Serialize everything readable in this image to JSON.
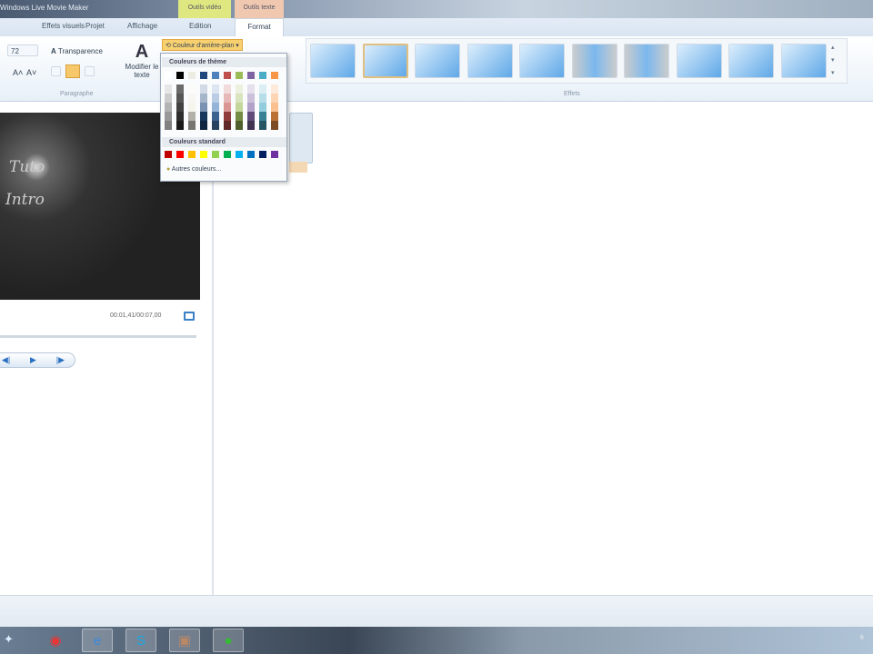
{
  "window": {
    "title": "Windows Live Movie Maker",
    "ctx_video": "Outils vidéo",
    "ctx_text": "Outils texte"
  },
  "tabs": [
    "Effets visuels",
    "Projet",
    "Affichage",
    "Edition",
    "Format"
  ],
  "ribbon": {
    "font_size": "72",
    "transparency": "Transparence",
    "modify_text": "Modifier le texte",
    "bg_color": "Couleur d'arrière-plan",
    "group_paragraph": "Paragraphe",
    "group_effects": "Effets"
  },
  "dropdown": {
    "theme_label": "Couleurs de thème",
    "standard_label": "Couleurs standard",
    "more_colors": "Autres couleurs...",
    "theme_top": [
      "#ffffff",
      "#000000",
      "#eeece1",
      "#1f497d",
      "#4f81bd",
      "#c0504d",
      "#9bbb59",
      "#8064a2",
      "#4bacc6",
      "#f79646"
    ],
    "standard": [
      "#c00000",
      "#ff0000",
      "#ffc000",
      "#ffff00",
      "#92d050",
      "#00b050",
      "#00b0f0",
      "#0070c0",
      "#002060",
      "#7030a0"
    ]
  },
  "preview": {
    "line1": "Tuto",
    "line2": "Intro",
    "time": "00:01,41/00:07,00"
  },
  "status": {
    "right": "fr"
  }
}
